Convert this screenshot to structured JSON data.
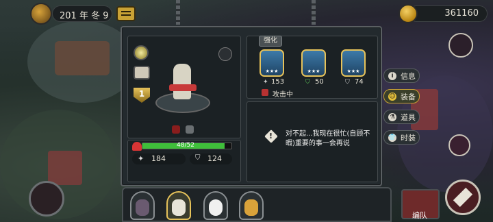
{
  "hud": {
    "date_text": "201 年 冬 9",
    "gold_amount": "361160"
  },
  "unit": {
    "badge_level": "1",
    "hp_text": "48/52",
    "hp_fraction": 0.923,
    "attack": "184",
    "defense": "124"
  },
  "upgrade": {
    "label": "强化",
    "cards": [
      {
        "value": "153",
        "stars": "★★★"
      },
      {
        "value": "50",
        "stars": "★★★"
      },
      {
        "value": "74",
        "stars": "★★★"
      }
    ],
    "status_text": "攻击中"
  },
  "dialog": {
    "message_line1": "对不起...我现在很忙(自顾不",
    "message_line2": "暇)重要的事一会再说"
  },
  "side_tabs": [
    {
      "label": "信息",
      "icon": "i"
    },
    {
      "label": "装备",
      "icon": "☺"
    },
    {
      "label": "道具",
      "icon": "⚗"
    },
    {
      "label": "时装",
      "icon": "👕"
    }
  ],
  "bottom": {
    "team_label": "编队"
  },
  "colors": {
    "hp_green": "#3fbf3a",
    "accent_gold": "#e6c25a",
    "active_tab": "#c9a235"
  }
}
